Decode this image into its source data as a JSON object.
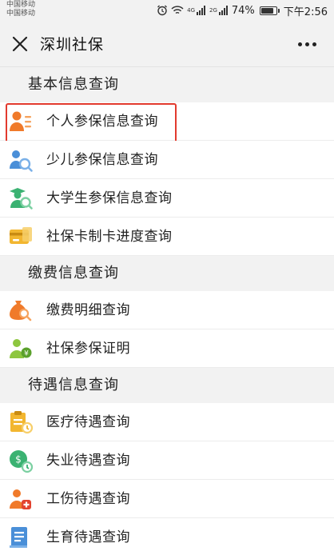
{
  "status_bar": {
    "carrier_1": "中国移动",
    "carrier_2": "中国移动",
    "net_1": "4G",
    "net_2": "2G",
    "battery": "74%",
    "battery_level": 0.74,
    "time": "下午2:56"
  },
  "header": {
    "title": "深圳社保"
  },
  "sections": [
    {
      "title": "基本信息查询",
      "items": [
        {
          "label": "个人参保信息查询",
          "icon": "person-id-card-icon",
          "highlighted": true
        },
        {
          "label": "少儿参保信息查询",
          "icon": "child-search-icon"
        },
        {
          "label": "大学生参保信息查询",
          "icon": "graduate-search-icon"
        },
        {
          "label": "社保卡制卡进度查询",
          "icon": "card-icon"
        }
      ]
    },
    {
      "title": "缴费信息查询",
      "items": [
        {
          "label": "缴费明细查询",
          "icon": "money-bag-search-icon"
        },
        {
          "label": "社保参保证明",
          "icon": "person-certificate-icon"
        }
      ]
    },
    {
      "title": "待遇信息查询",
      "items": [
        {
          "label": "医疗待遇查询",
          "icon": "medical-clipboard-icon"
        },
        {
          "label": "失业待遇查询",
          "icon": "unemployment-coin-icon"
        },
        {
          "label": "工伤待遇查询",
          "icon": "injury-person-icon"
        },
        {
          "label": "生育待遇查询",
          "icon": "maternity-document-icon"
        }
      ]
    }
  ],
  "colors": {
    "highlight_border": "#e23a2e",
    "icon_orange": "#f07a2a",
    "icon_blue": "#4a8fd8",
    "icon_green": "#3bb272",
    "icon_yellow": "#f2b630"
  }
}
